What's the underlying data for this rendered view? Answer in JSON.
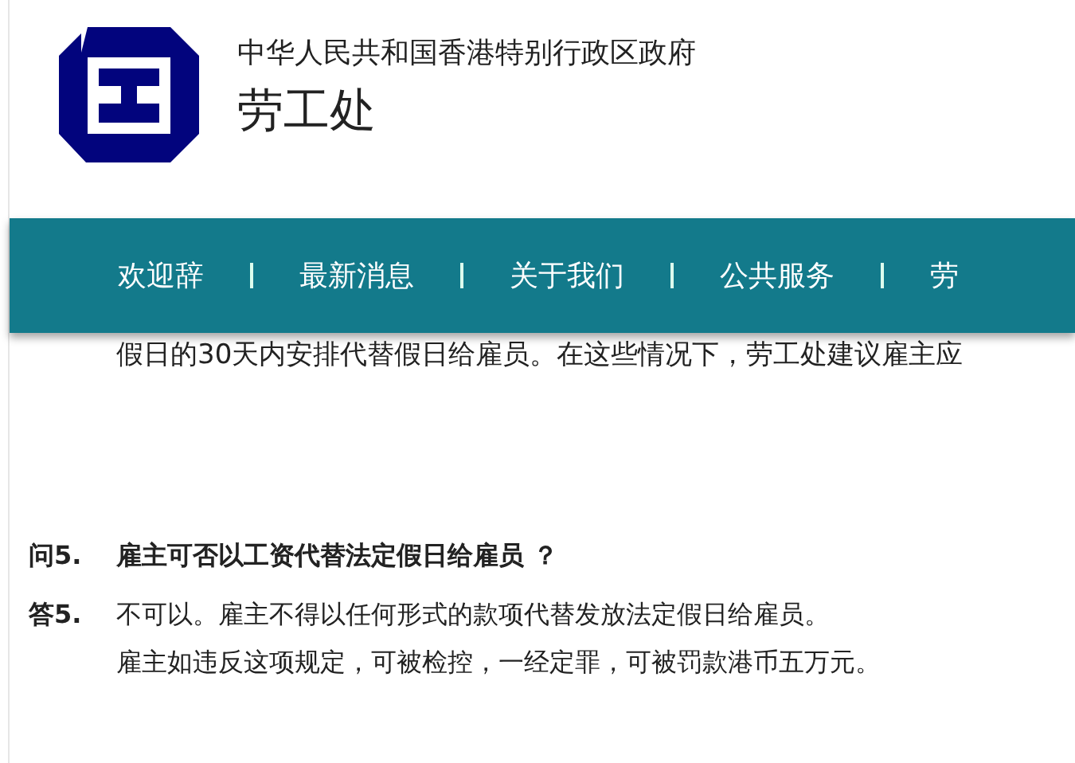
{
  "header": {
    "government": "中华人民共和国香港特别行政区政府",
    "department": "劳工处"
  },
  "nav": {
    "items": [
      {
        "label": "欢迎辞"
      },
      {
        "label": "最新消息"
      },
      {
        "label": "关于我们"
      },
      {
        "label": "公共服务"
      },
      {
        "label": "劳"
      }
    ]
  },
  "partial_line": "假日的30天内安排代替假日给雇员。在这些情况下，劳工处建议雇主应",
  "faq": [
    {
      "label": "问5.",
      "text": "雇主可否以工资代替法定假日给雇员 ？",
      "kind": "question"
    },
    {
      "label": "答5.",
      "lines": [
        "不可以。雇主不得以任何形式的款项代替发放法定假日给雇员。",
        "雇主如违反这项规定，可被检控，一经定罪，可被罚款港币五万元。"
      ],
      "kind": "answer"
    }
  ]
}
